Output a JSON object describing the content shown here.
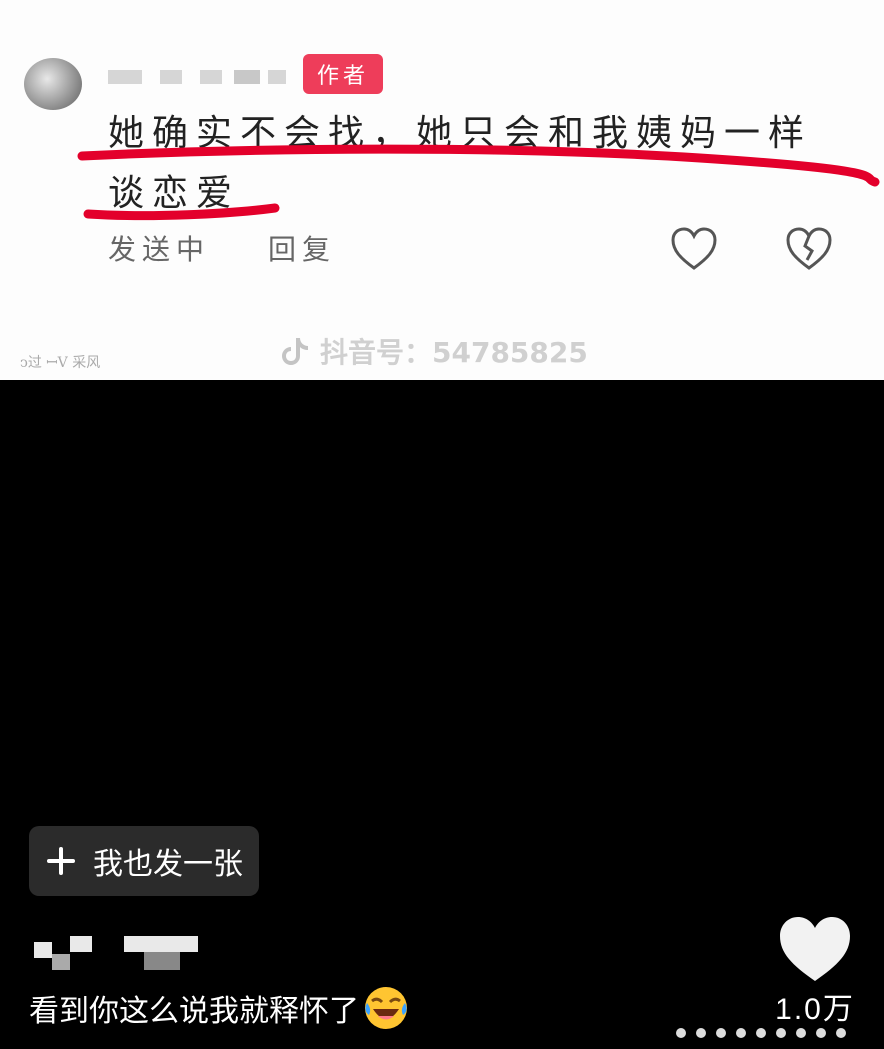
{
  "comment_card": {
    "author_badge": "作者",
    "text": "她确实不会找，她只会和我姨妈一样谈恋爱",
    "status": "发送中",
    "reply": "回复",
    "watermark": "抖音号：54785825",
    "corner_mark": "ↄ过 ꟷV 采风",
    "underline_color": "#e3002b"
  },
  "overlay": {
    "post_button_label": "我也发一张",
    "caption": "看到你这么说我就释怀了",
    "caption_emoji": "laughing-crying-emoji",
    "like_count": "1.0万"
  },
  "colors": {
    "accent_tag": "#ee3d5a",
    "background": "#000000",
    "button_bg": "#2b2b2b"
  }
}
